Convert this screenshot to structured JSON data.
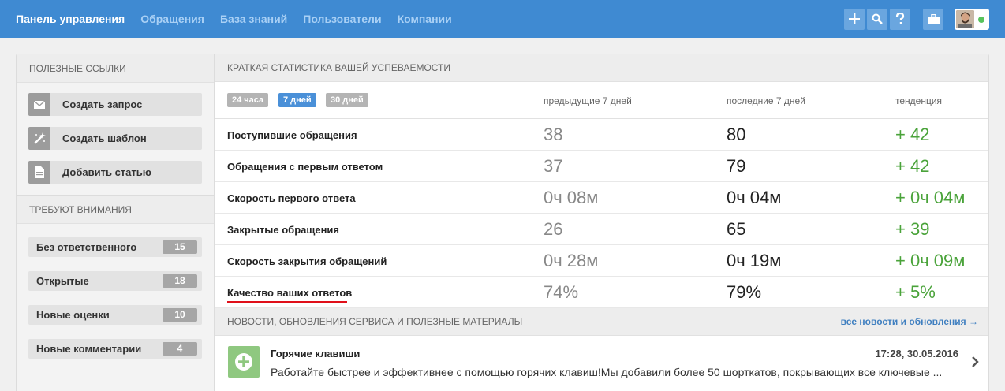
{
  "nav": {
    "items": [
      {
        "label": "Панель управления",
        "active": true
      },
      {
        "label": "Обращения",
        "active": false
      },
      {
        "label": "База знаний",
        "active": false
      },
      {
        "label": "Пользователи",
        "active": false
      },
      {
        "label": "Компании",
        "active": false
      }
    ],
    "tools": [
      "plus-icon",
      "search-icon",
      "help-icon",
      "briefcase-icon"
    ],
    "status_color": "#58c35c"
  },
  "links": {
    "title": "ПОЛЕЗНЫЕ ССЫЛКИ",
    "items": [
      {
        "label": "Создать запрос",
        "icon": "envelope-icon"
      },
      {
        "label": "Создать шаблон",
        "icon": "magic-wand-icon"
      },
      {
        "label": "Добавить статью",
        "icon": "document-icon"
      }
    ]
  },
  "attention": {
    "title": "ТРЕБУЮТ ВНИМАНИЯ",
    "items": [
      {
        "label": "Без ответственного",
        "count": "15"
      },
      {
        "label": "Открытые",
        "count": "18"
      },
      {
        "label": "Новые оценки",
        "count": "10"
      },
      {
        "label": "Новые комментарии",
        "count": "4"
      }
    ]
  },
  "stats": {
    "title": "КРАТКАЯ СТАТИСТИКА ВАШЕЙ УСПЕВАЕМОСТИ",
    "periods": [
      {
        "label": "24 часа",
        "active": false
      },
      {
        "label": "7 дней",
        "active": true
      },
      {
        "label": "30 дней",
        "active": false
      }
    ],
    "columns": {
      "prev": "предыдущие 7 дней",
      "last": "последние 7 дней",
      "trend": "тенденция"
    },
    "rows": [
      {
        "name": "Поступившие обращения",
        "prev": "38",
        "last": "80",
        "trend": "+ 42"
      },
      {
        "name": "Обращения с первым ответом",
        "prev": "37",
        "last": "79",
        "trend": "+ 42"
      },
      {
        "name": "Скорость первого ответа",
        "prev": "0ч 08м",
        "last": "0ч 04м",
        "trend": "+ 0ч 04м"
      },
      {
        "name": "Закрытые обращения",
        "prev": "26",
        "last": "65",
        "trend": "+ 39"
      },
      {
        "name": "Скорость закрытия обращений",
        "prev": "0ч 28м",
        "last": "0ч 19м",
        "trend": "+ 0ч 09м"
      },
      {
        "name": "Качество ваших ответов",
        "prev": "74%",
        "last": "79%",
        "trend": "+ 5%"
      }
    ],
    "trend_color": "#4aa33a"
  },
  "news": {
    "title": "НОВОСТИ, ОБНОВЛЕНИЯ СЕРВИСА И ПОЛЕЗНЫЕ МАТЕРИАЛЫ",
    "all_link": "все новости и обновления →",
    "item": {
      "title": "Горячие клавиши",
      "date": "17:28, 30.05.2016",
      "text": "Работайте быстрее и эффективнее с помощью горячих клавиш!Мы добавили более 50 шорткатов, покрывающих все ключевые ..."
    }
  }
}
